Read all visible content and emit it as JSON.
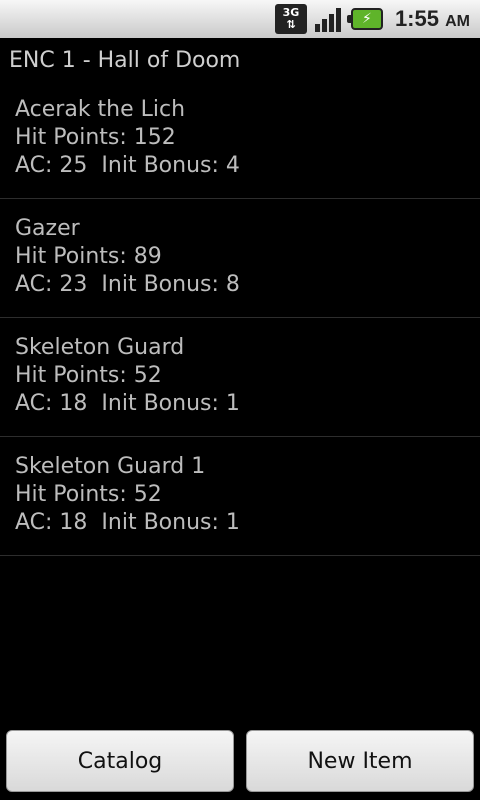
{
  "status_bar": {
    "network_label_top": "3G",
    "network_label_bottom": "⇅",
    "time": "1:55",
    "ampm": "AM",
    "battery_color": "#5fb42a"
  },
  "header": {
    "title": "ENC 1 - Hall of Doom"
  },
  "monsters": [
    {
      "name": "Acerak the Lich",
      "hp": "Hit Points: 152",
      "stats": "AC: 25  Init Bonus: 4"
    },
    {
      "name": "Gazer",
      "hp": "Hit Points: 89",
      "stats": "AC: 23  Init Bonus: 8"
    },
    {
      "name": "Skeleton Guard",
      "hp": "Hit Points: 52",
      "stats": "AC: 18  Init Bonus: 1"
    },
    {
      "name": "Skeleton Guard 1",
      "hp": "Hit Points: 52",
      "stats": "AC: 18  Init Bonus: 1"
    }
  ],
  "buttons": {
    "catalog": "Catalog",
    "new_item": "New Item"
  }
}
